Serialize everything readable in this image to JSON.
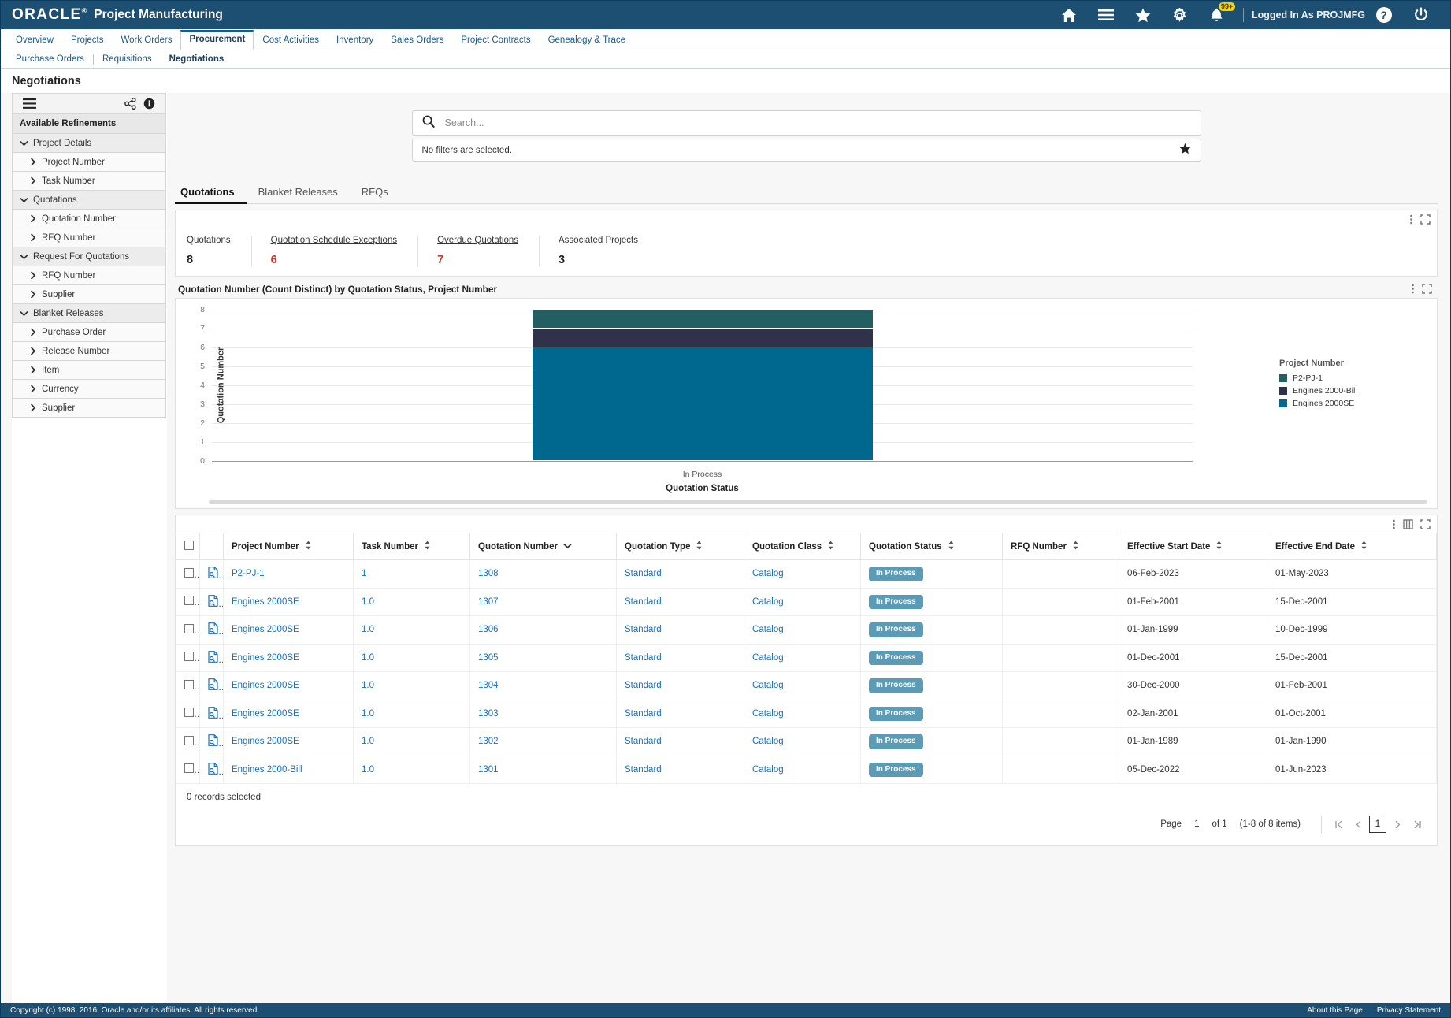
{
  "header": {
    "brand": "ORACLE",
    "brand_reg": "®",
    "app_title": "Project Manufacturing",
    "notifications_badge": "99+",
    "logged_in_as": "Logged In As PROJMFG",
    "help_label": "?",
    "icons": [
      "home-icon",
      "menu-icon",
      "favorites-star-icon",
      "settings-gear-icon",
      "notifications-bell-icon",
      "help-icon",
      "power-logout-icon"
    ]
  },
  "nav": {
    "tabs": [
      {
        "label": "Overview",
        "active": false
      },
      {
        "label": "Projects",
        "active": false
      },
      {
        "label": "Work Orders",
        "active": false
      },
      {
        "label": "Procurement",
        "active": true
      },
      {
        "label": "Cost Activities",
        "active": false
      },
      {
        "label": "Inventory",
        "active": false
      },
      {
        "label": "Sales Orders",
        "active": false
      },
      {
        "label": "Project Contracts",
        "active": false
      },
      {
        "label": "Genealogy & Trace",
        "active": false
      }
    ],
    "subtabs": [
      {
        "label": "Purchase Orders",
        "active": false
      },
      {
        "label": "Requisitions",
        "active": false
      },
      {
        "label": "Negotiations",
        "active": true
      }
    ]
  },
  "page_title": "Negotiations",
  "sidebar": {
    "header": "Available Refinements",
    "items": [
      {
        "label": "Project Details",
        "type": "group"
      },
      {
        "label": "Project Number",
        "type": "child"
      },
      {
        "label": "Task Number",
        "type": "child"
      },
      {
        "label": "Quotations",
        "type": "group"
      },
      {
        "label": "Quotation Number",
        "type": "child"
      },
      {
        "label": "RFQ Number",
        "type": "child"
      },
      {
        "label": "Request For Quotations",
        "type": "group"
      },
      {
        "label": "RFQ Number",
        "type": "child"
      },
      {
        "label": "Supplier",
        "type": "child"
      },
      {
        "label": "Blanket Releases",
        "type": "group"
      },
      {
        "label": "Purchase Order",
        "type": "child"
      },
      {
        "label": "Release Number",
        "type": "child"
      },
      {
        "label": "Item",
        "type": "child"
      },
      {
        "label": "Currency",
        "type": "child"
      },
      {
        "label": "Supplier",
        "type": "child"
      }
    ]
  },
  "search": {
    "placeholder": "Search...",
    "value": "",
    "filter_text": "No filters are selected."
  },
  "content_tabs": [
    {
      "label": "Quotations",
      "active": true
    },
    {
      "label": "Blanket Releases",
      "active": false
    },
    {
      "label": "RFQs",
      "active": false
    }
  ],
  "kpis": [
    {
      "label": "Quotations",
      "value": "8",
      "alert": false,
      "link": false
    },
    {
      "label": "Quotation Schedule Exceptions",
      "value": "6",
      "alert": true,
      "link": true
    },
    {
      "label": "Overdue Quotations",
      "value": "7",
      "alert": true,
      "link": true
    },
    {
      "label": "Associated Projects",
      "value": "3",
      "alert": false,
      "link": false
    }
  ],
  "chart_data": {
    "type": "bar",
    "title": "Quotation Number (Count Distinct) by Quotation Status, Project Number",
    "xlabel": "Quotation Status",
    "ylabel": "Quotation Number",
    "categories": [
      "In Process"
    ],
    "ylim": [
      0,
      8
    ],
    "yticks": [
      0,
      1,
      2,
      3,
      4,
      5,
      6,
      7,
      8
    ],
    "grid": true,
    "stacked": true,
    "legend_title": "Project Number",
    "legend_position": "right",
    "series": [
      {
        "name": "Engines 2000SE",
        "values": [
          6
        ],
        "color": "#00688f"
      },
      {
        "name": "Engines 2000-Bill",
        "values": [
          1
        ],
        "color": "#2f3249"
      },
      {
        "name": "P2-PJ-1",
        "values": [
          1
        ],
        "color": "#235e63"
      }
    ]
  },
  "table": {
    "columns": [
      {
        "label": "Project Number",
        "sort": "both"
      },
      {
        "label": "Task Number",
        "sort": "both"
      },
      {
        "label": "Quotation Number",
        "sort": "desc"
      },
      {
        "label": "Quotation Type",
        "sort": "both"
      },
      {
        "label": "Quotation Class",
        "sort": "both"
      },
      {
        "label": "Quotation Status",
        "sort": "both"
      },
      {
        "label": "RFQ Number",
        "sort": "both"
      },
      {
        "label": "Effective Start Date",
        "sort": "both"
      },
      {
        "label": "Effective End Date",
        "sort": "both"
      }
    ],
    "rows": [
      {
        "project": "P2-PJ-1",
        "task": "1",
        "quotation": "1308",
        "type": "Standard",
        "class": "Catalog",
        "status": "In Process",
        "rfq": "",
        "start": "06-Feb-2023",
        "end": "01-May-2023"
      },
      {
        "project": "Engines 2000SE",
        "task": "1.0",
        "quotation": "1307",
        "type": "Standard",
        "class": "Catalog",
        "status": "In Process",
        "rfq": "",
        "start": "01-Feb-2001",
        "end": "15-Dec-2001"
      },
      {
        "project": "Engines 2000SE",
        "task": "1.0",
        "quotation": "1306",
        "type": "Standard",
        "class": "Catalog",
        "status": "In Process",
        "rfq": "",
        "start": "01-Jan-1999",
        "end": "10-Dec-1999"
      },
      {
        "project": "Engines 2000SE",
        "task": "1.0",
        "quotation": "1305",
        "type": "Standard",
        "class": "Catalog",
        "status": "In Process",
        "rfq": "",
        "start": "01-Dec-2001",
        "end": "15-Dec-2001"
      },
      {
        "project": "Engines 2000SE",
        "task": "1.0",
        "quotation": "1304",
        "type": "Standard",
        "class": "Catalog",
        "status": "In Process",
        "rfq": "",
        "start": "30-Dec-2000",
        "end": "01-Feb-2001"
      },
      {
        "project": "Engines 2000SE",
        "task": "1.0",
        "quotation": "1303",
        "type": "Standard",
        "class": "Catalog",
        "status": "In Process",
        "rfq": "",
        "start": "02-Jan-2001",
        "end": "01-Oct-2001"
      },
      {
        "project": "Engines 2000SE",
        "task": "1.0",
        "quotation": "1302",
        "type": "Standard",
        "class": "Catalog",
        "status": "In Process",
        "rfq": "",
        "start": "01-Jan-1989",
        "end": "01-Jan-1990"
      },
      {
        "project": "Engines 2000-Bill",
        "task": "1.0",
        "quotation": "1301",
        "type": "Standard",
        "class": "Catalog",
        "status": "In Process",
        "rfq": "",
        "start": "05-Dec-2022",
        "end": "01-Jun-2023"
      }
    ],
    "records_selected": "0 records selected",
    "pager": {
      "page_label": "Page",
      "page_value": "1",
      "of_label": "of 1",
      "range": "(1-8 of 8 items)",
      "current": "1"
    }
  },
  "footer": {
    "copyright": "Copyright (c) 1998, 2016, Oracle and/or its affiliates. All rights reserved.",
    "about": "About this Page",
    "privacy": "Privacy Statement"
  }
}
